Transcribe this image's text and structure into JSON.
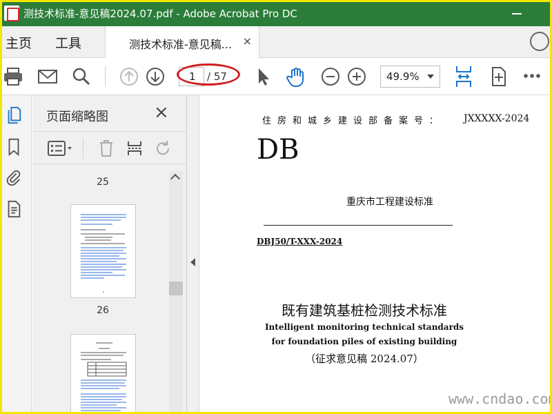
{
  "window": {
    "title": "测技术标准-意见稿2024.07.pdf - Adobe Acrobat Pro DC"
  },
  "tabbar": {
    "home_label": "主页",
    "tools_label": "工具",
    "doc_tab_label": "测技术标准-意见稿...",
    "doc_tab_close": "×"
  },
  "toolbar": {
    "current_page": "1",
    "total_pages": "/ 57",
    "zoom_value": "49.9%"
  },
  "thumbnails": {
    "title": "页面缩略图",
    "close": "×",
    "page_labels": [
      "25",
      "26"
    ]
  },
  "document": {
    "record_label": "住房和城乡建设部备案号：",
    "record_code": "JXXXXX-2024",
    "db_mark": "DB",
    "issuer": "重庆市工程建设标准",
    "standard_no": "DBJ50/T-XXX-2024",
    "title_cn": "既有建筑基桩检测技术标准",
    "title_en": "Intelligent monitoring technical standards for foundation piles of existing building",
    "draft_note": "（征求意见稿 2024.07）"
  },
  "watermark": "www.cndao.com",
  "colors": {
    "titlebar": "#2b7d3a",
    "accent_blue": "#1a73c8",
    "annotation_red": "#d11c1c"
  }
}
